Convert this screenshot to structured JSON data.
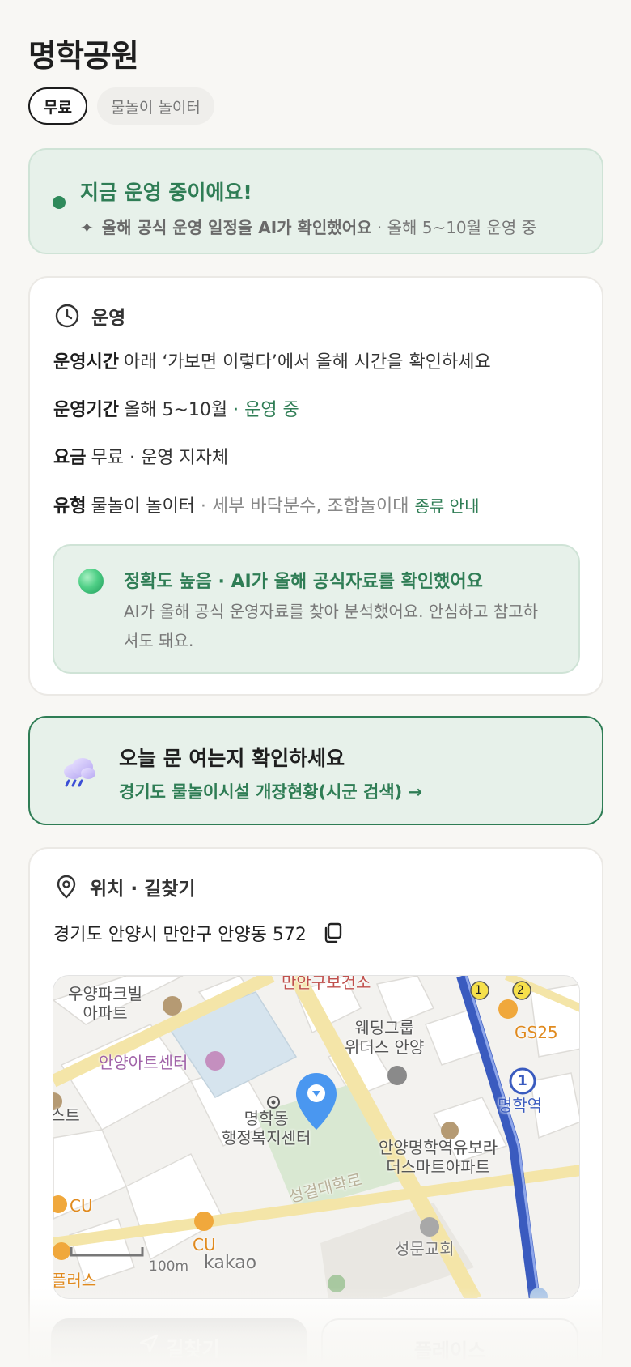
{
  "page": {
    "title": "명학공원",
    "chips": [
      {
        "label": "무료"
      },
      {
        "label": "물놀이 놀이터"
      }
    ]
  },
  "status": {
    "title": "지금 운영 중이에요!",
    "sub_strong": "올해 공식 운영 일정을 AI가 확인했어요",
    "sub_dim": " · 올해 5~10월 운영 중",
    "spark_icon": "sparkle-icon"
  },
  "operation": {
    "heading": "운영",
    "rows": {
      "hours": {
        "key": "운영시간",
        "value": "아래 ‘가보면 이렇다’에서 올해 시간을 확인하세요"
      },
      "period": {
        "key": "운영기간",
        "value": "올해 5~10월",
        "extra": " · 운영 중"
      },
      "fee": {
        "key": "요금",
        "value": "무료",
        "extra": " · 운영 지자체"
      },
      "type": {
        "key": "유형",
        "value": "물놀이 놀이터",
        "extra": " · 세부 바닥분수, 조합놀이대 ",
        "link": "종류 안내"
      }
    },
    "accuracy": {
      "title": "정확도 높음 · AI가 올해 공식자료를 확인했어요",
      "body": "AI가 올해 공식 운영자료를 찾아 분석했어요. 안심하고 참고하셔도 돼요."
    }
  },
  "today": {
    "title": "오늘 문 여는지 확인하세요",
    "link": "경기도 물놀이시설 개장현황(시군 검색) →"
  },
  "location": {
    "heading": "위치 · 길찾기",
    "address": "경기도 안양시 만안구 안양동 572",
    "map_labels": {
      "l1": "우양파크빌",
      "l1b": "아파트",
      "l2": "만안구보건소",
      "l3": "웨딩그룹",
      "l3b": "위더스 안양",
      "l4": "GS25",
      "l5": "안양아트센터",
      "l6": "명학역",
      "l7": "명학동",
      "l7b": "행정복지센터",
      "l8": "안양명학역유보라",
      "l8b": "더스마트아파트",
      "l9": "CU",
      "l10": "성결대학로",
      "l11": "성문교회",
      "l12": "CU",
      "l13": "100m",
      "l14": "kakao",
      "l15": "스트",
      "l16": "플러스",
      "badge1": "1",
      "badge2": "2",
      "station_num": "1"
    }
  },
  "actions": {
    "directions": "길찾기",
    "place": "플레이스"
  },
  "colors": {
    "accent_green": "#2f7d55",
    "status_bg": "#e7f1ea",
    "marker_blue": "#4a97f0"
  }
}
